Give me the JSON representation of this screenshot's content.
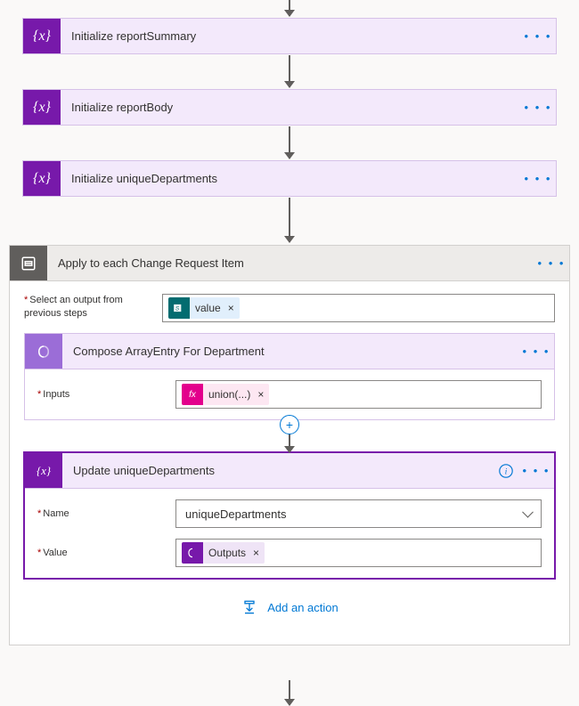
{
  "cards": {
    "summary": {
      "title": "Initialize reportSummary"
    },
    "body": {
      "title": "Initialize reportBody"
    },
    "unique": {
      "title": "Initialize uniqueDepartments"
    }
  },
  "container": {
    "title": "Apply to each Change Request Item",
    "selectlabel": "Select an output from previous steps",
    "compose": {
      "title": "Compose ArrayEntry For Department",
      "inputs_label": "Inputs"
    },
    "update": {
      "title": "Update uniqueDepartments",
      "name_label": "Name",
      "value_label": "Value",
      "name_value": "uniqueDepartments"
    },
    "add_action": "Add an action"
  },
  "tokens": {
    "value": "value",
    "union": "union(...)",
    "outputs": "Outputs",
    "fx": "fx",
    "x": "×"
  },
  "icons": {
    "dots": "• • •"
  }
}
